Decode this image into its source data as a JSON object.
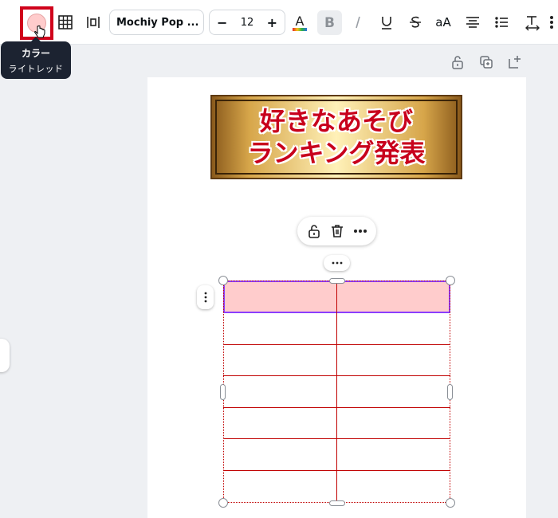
{
  "toolbar": {
    "color_swatch": "#ffcccc",
    "font_name": "Mochiy Pop ...",
    "font_size": "12",
    "size_minus": "−",
    "size_plus": "+",
    "bold": "B",
    "case": "aA"
  },
  "tooltip": {
    "title": "カラー",
    "subtitle": "ライトレッド"
  },
  "banner": {
    "line1": "好きなあそび",
    "line2": "ランキング発表"
  },
  "colors": {
    "accent_purple": "#8b3dff",
    "table_red": "#c00000",
    "highlight_red": "#d0021b"
  }
}
